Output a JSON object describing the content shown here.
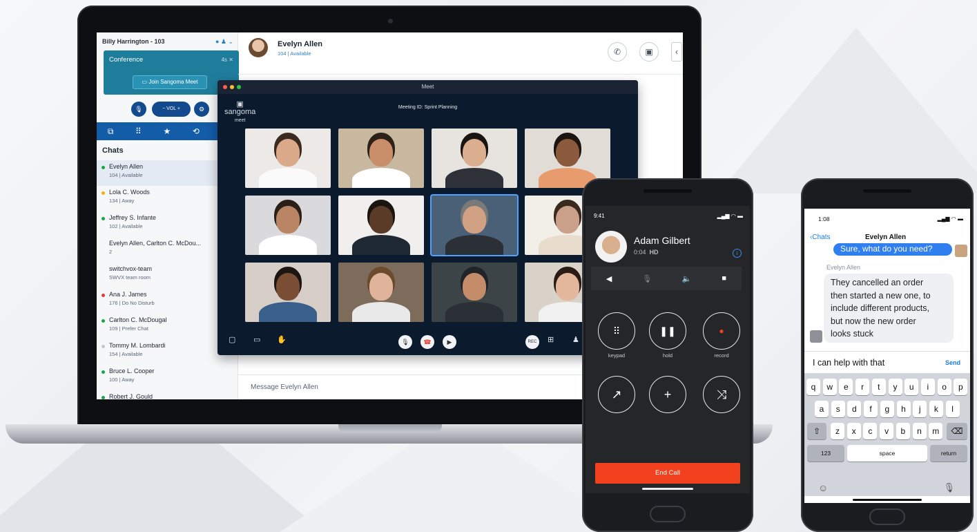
{
  "desktop": {
    "user": {
      "name": "Billy Harrington - 103"
    },
    "conference": {
      "title": "Conference",
      "timer": "4s",
      "join_label": "Join Sangoma Meet"
    },
    "controls": {
      "vol_label": "VOL"
    },
    "chats_heading": "Chats",
    "chats": [
      {
        "name": "Evelyn Allen",
        "status": "104 | Available",
        "presence": "available"
      },
      {
        "name": "Lola C. Woods",
        "status": "134 | Away",
        "presence": "away"
      },
      {
        "name": "Jeffrey S. Infante",
        "status": "102 | Available",
        "presence": "available"
      },
      {
        "name": "Evelyn Allen, Carlton C. McDou...",
        "status": "2",
        "presence": "group"
      },
      {
        "name": "switchvox-team",
        "status": "SWVX team room",
        "presence": "room"
      },
      {
        "name": "Ana J. James",
        "status": "176 | Do No Disturb",
        "presence": "dnd"
      },
      {
        "name": "Carlton C. McDougal",
        "status": "109 | Prefer Chat",
        "presence": "available"
      },
      {
        "name": "Tommy M. Lombardi",
        "status": "154 | Available",
        "presence": "offline"
      },
      {
        "name": "Bruce L. Cooper",
        "status": "100 | Away",
        "presence": "available"
      },
      {
        "name": "Robert J. Gould",
        "status": "",
        "presence": "available"
      }
    ],
    "contact": {
      "name": "Evelyn Allen",
      "status": "104 | Available"
    },
    "message_placeholder": "Message Evelyn Allen"
  },
  "meet": {
    "window_title": "Meet",
    "brand": "sangoma",
    "brand_sub": "meet",
    "meeting_id": "Meeting ID: Sprint Planning"
  },
  "call_phone": {
    "time": "9:41",
    "caller": "Adam Gilbert",
    "duration": "0:04",
    "quality": "HD",
    "buttons": [
      {
        "label": "keypad"
      },
      {
        "label": "hold"
      },
      {
        "label": "record"
      }
    ],
    "end_call": "End Call"
  },
  "chat_phone": {
    "time": "1:08",
    "back": "Chats",
    "title": "Evelyn Allen",
    "outgoing": "Sure, what do you need?",
    "sender": "Evelyn Allen",
    "incoming_lines": [
      "They cancelled an order",
      "then started a new one, to",
      "include different products,",
      "but now the new order",
      "looks stuck"
    ],
    "input_value": "I can help with that",
    "send": "Send",
    "keyboard": {
      "row1": [
        "q",
        "w",
        "e",
        "r",
        "t",
        "y",
        "u",
        "i",
        "o",
        "p"
      ],
      "row2": [
        "a",
        "s",
        "d",
        "f",
        "g",
        "h",
        "j",
        "k",
        "l"
      ],
      "row3": [
        "z",
        "x",
        "c",
        "v",
        "b",
        "n",
        "m"
      ],
      "num": "123",
      "space": "space",
      "return": "return"
    }
  },
  "colors": {
    "brand_blue": "#135ca8",
    "conference_teal": "#1f7d9c",
    "end_call": "#f1411f",
    "imessage_blue": "#2f7fef"
  }
}
